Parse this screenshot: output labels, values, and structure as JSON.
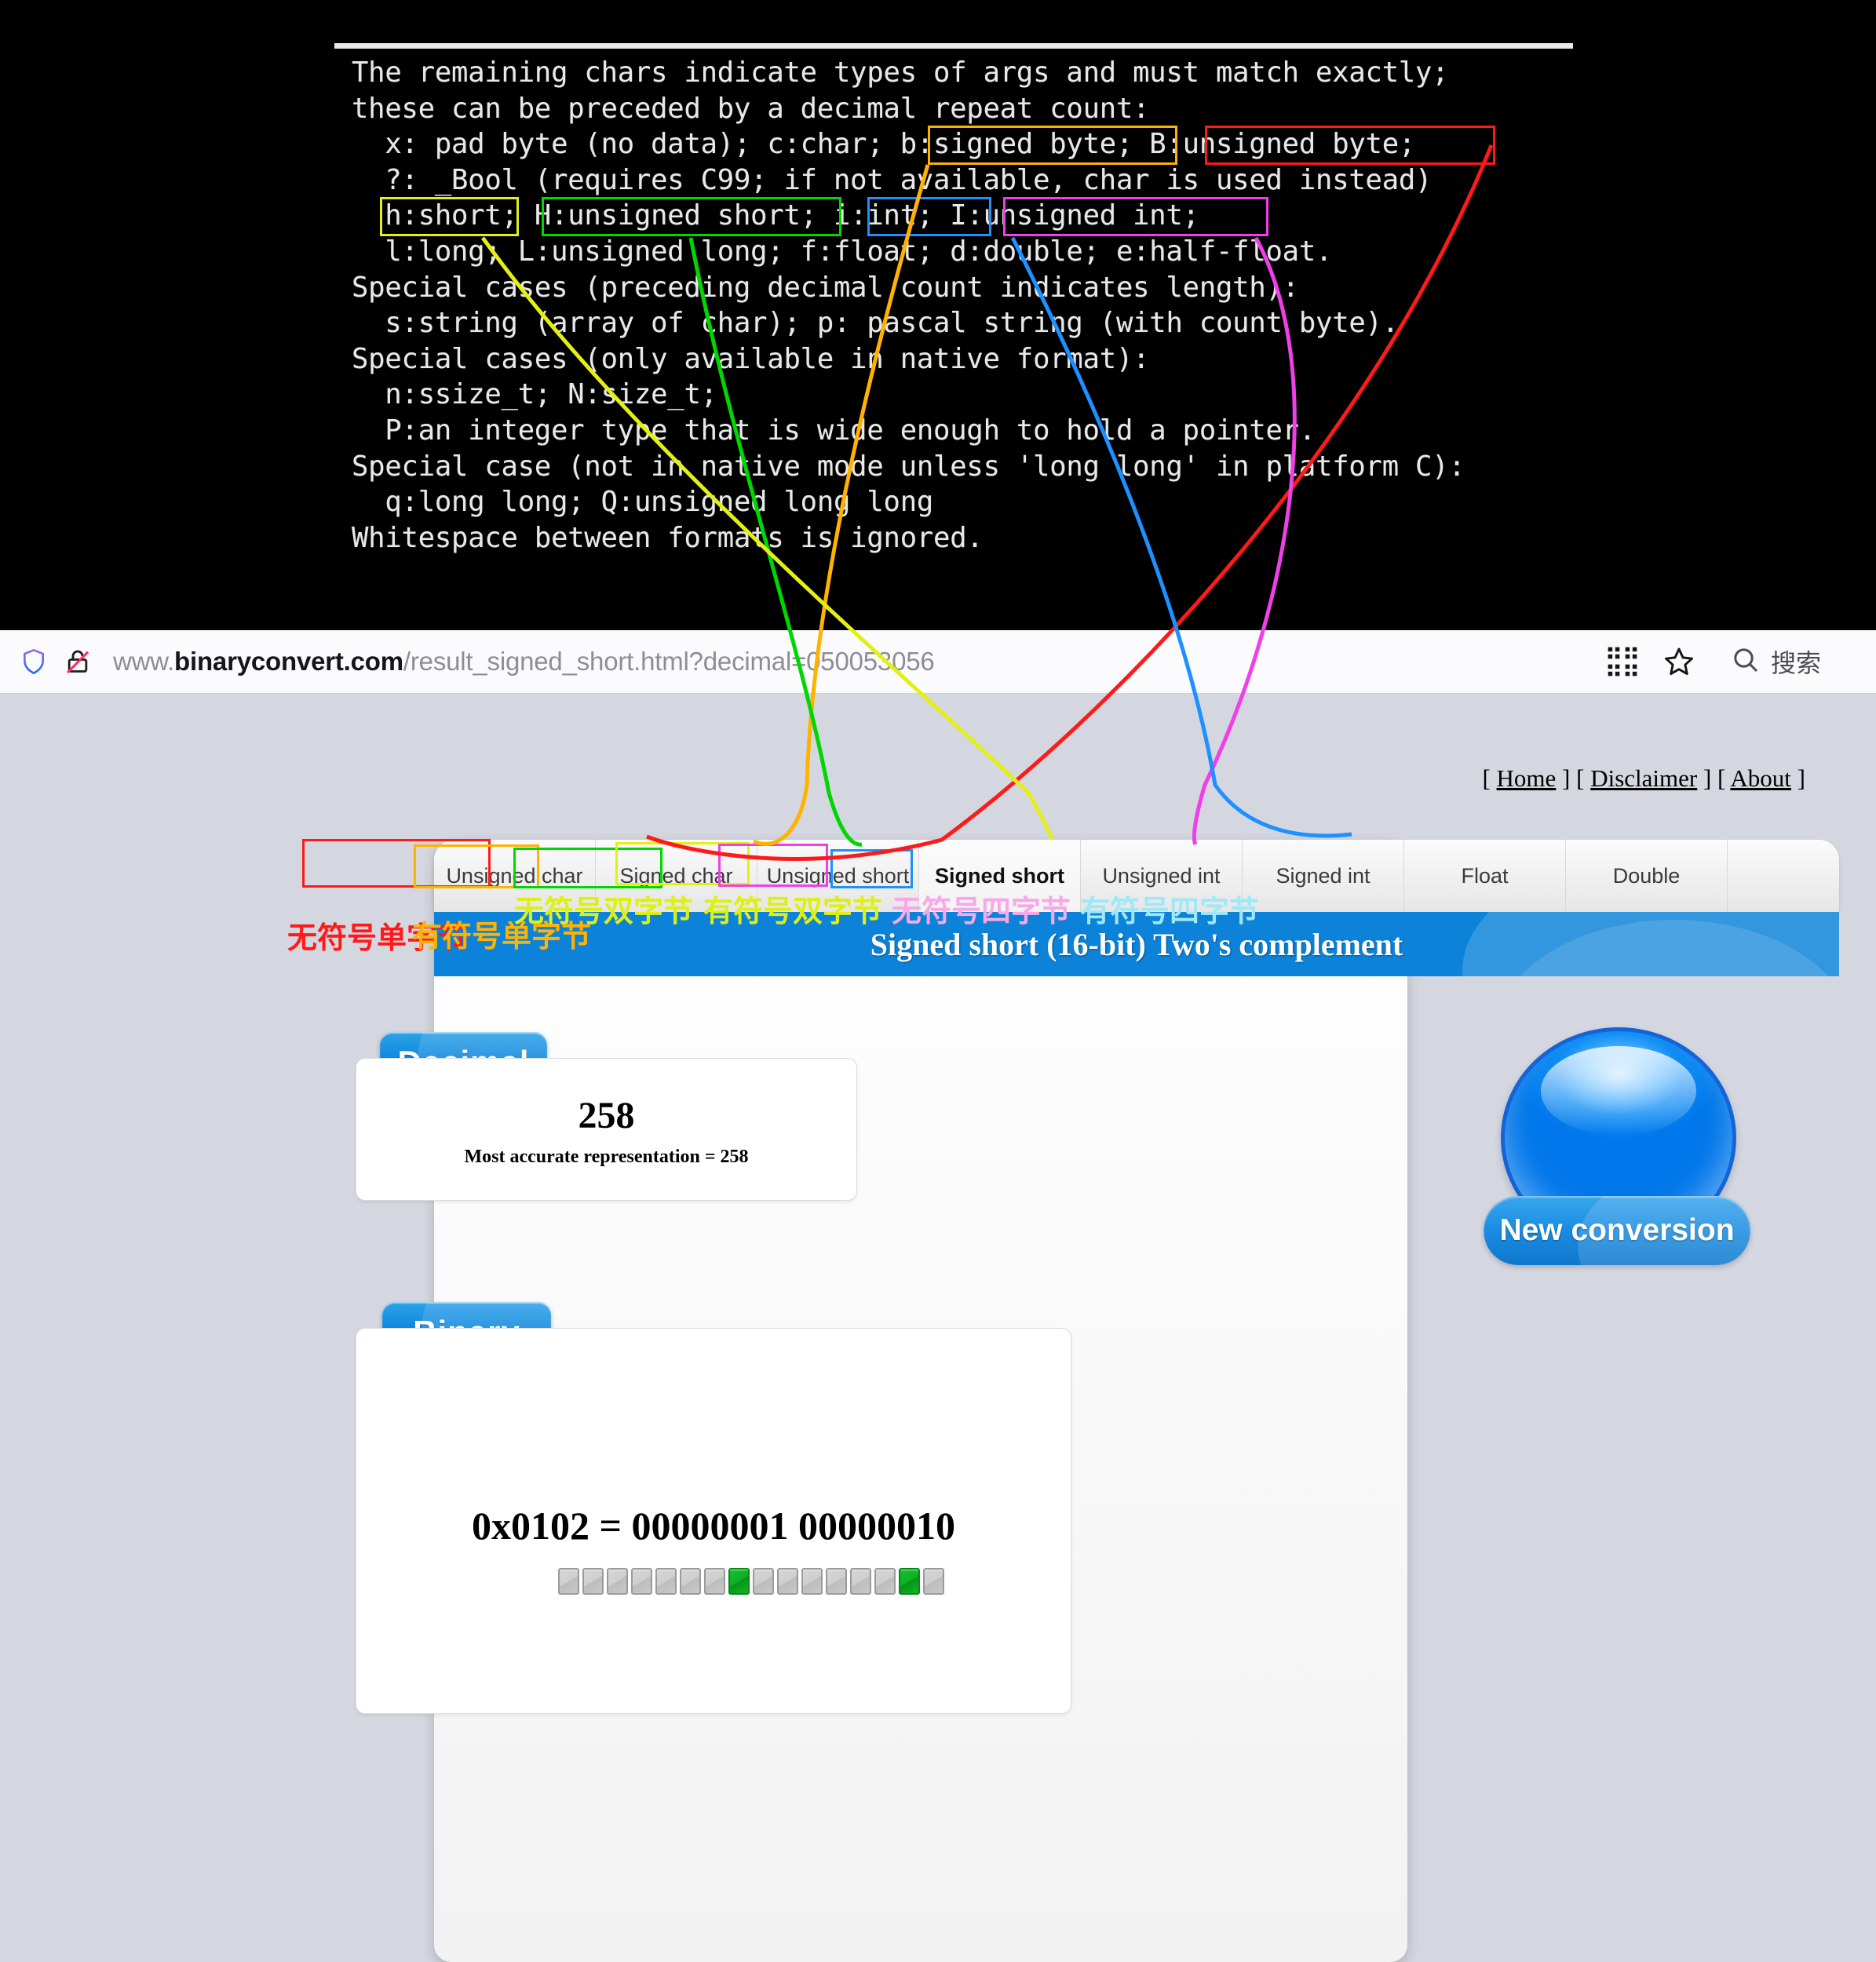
{
  "terminal": {
    "lines": [
      "The remaining chars indicate types of args and must match exactly;",
      "these can be preceded by a decimal repeat count:",
      "  x: pad byte (no data); c:char; b:signed byte; B:unsigned byte;",
      "  ?: _Bool (requires C99; if not available, char is used instead)",
      "  h:short; H:unsigned short; i:int; I:unsigned int;",
      "  l:long; L:unsigned long; f:float; d:double; e:half-float.",
      "Special cases (preceding decimal count indicates length):",
      "  s:string (array of char); p: pascal string (with count byte).",
      "Special cases (only available in native format):",
      "  n:ssize_t; N:size_t;",
      "  P:an integer type that is wide enough to hold a pointer.",
      "Special case (not in native mode unless 'long long' in platform C):",
      "  q:long long; Q:unsigned long long",
      "Whitespace between formats is ignored."
    ]
  },
  "browser": {
    "shield_icon": "shield-icon",
    "lock_icon": "lock-crossed-icon",
    "url_prefix": "www.",
    "url_domain": "binaryconvert.com",
    "url_path": "/result_signed_short.html?decimal=050053056",
    "qr_icon": "qr-code-icon",
    "star_icon": "bookmark-star-icon",
    "search_icon": "search-icon",
    "search_label": "搜索"
  },
  "page": {
    "top_links": [
      {
        "label": "Home"
      },
      {
        "label": "Disclaimer"
      },
      {
        "label": "About"
      }
    ],
    "bracket_open": "[",
    "bracket_close": "]",
    "title": "Signed short (16-bit) Two's complement",
    "tabs": [
      {
        "label": "Unsigned char",
        "active": false
      },
      {
        "label": "Signed char",
        "active": false
      },
      {
        "label": "Unsigned short",
        "active": false
      },
      {
        "label": "Signed short",
        "active": true
      },
      {
        "label": "Unsigned int",
        "active": false
      },
      {
        "label": "Signed int",
        "active": false
      },
      {
        "label": "Float",
        "active": false
      },
      {
        "label": "Double",
        "active": false
      }
    ],
    "decimal": {
      "pill_label": "Decimal",
      "value": "258",
      "note": "Most accurate representation = 258"
    },
    "binary": {
      "pill_label": "Binary",
      "value": "0x0102 = 00000001 00000010",
      "bits": [
        0,
        0,
        0,
        0,
        0,
        0,
        0,
        1,
        0,
        0,
        0,
        0,
        0,
        0,
        1,
        0
      ]
    },
    "new_conversion": {
      "label": "New conversion"
    }
  },
  "annotations": {
    "colors": {
      "unsigned_char": "#ff1a1a",
      "signed_char": "#ffb300",
      "unsigned_short": "#00d700",
      "signed_short": "#e3f014",
      "unsigned_int": "#ef3fe8",
      "signed_int": "#1e90ff"
    },
    "cn_labels": [
      {
        "text": "无符号单字节",
        "color": "#ff1a1a"
      },
      {
        "text": "有符号单字节",
        "color": "#ffb300"
      },
      {
        "text": "无符号双字节",
        "color": "#ddf016"
      },
      {
        "text": "有符号双字节",
        "color": "#ddf016"
      },
      {
        "text": "无符号四字节",
        "color": "#f7a8e8"
      },
      {
        "text": "有符号四字节",
        "color": "#9fe8f7"
      }
    ],
    "term_boxes": [
      {
        "label": "b:signed byte",
        "color": "#ffb300"
      },
      {
        "label": "B:unsigned byte",
        "color": "#ff1a1a"
      },
      {
        "label": "h:short",
        "color": "#e3f014"
      },
      {
        "label": "H:unsigned short",
        "color": "#00d700"
      },
      {
        "label": "i:int",
        "color": "#1e90ff"
      },
      {
        "label": "I:unsigned int",
        "color": "#ef3fe8"
      }
    ]
  }
}
